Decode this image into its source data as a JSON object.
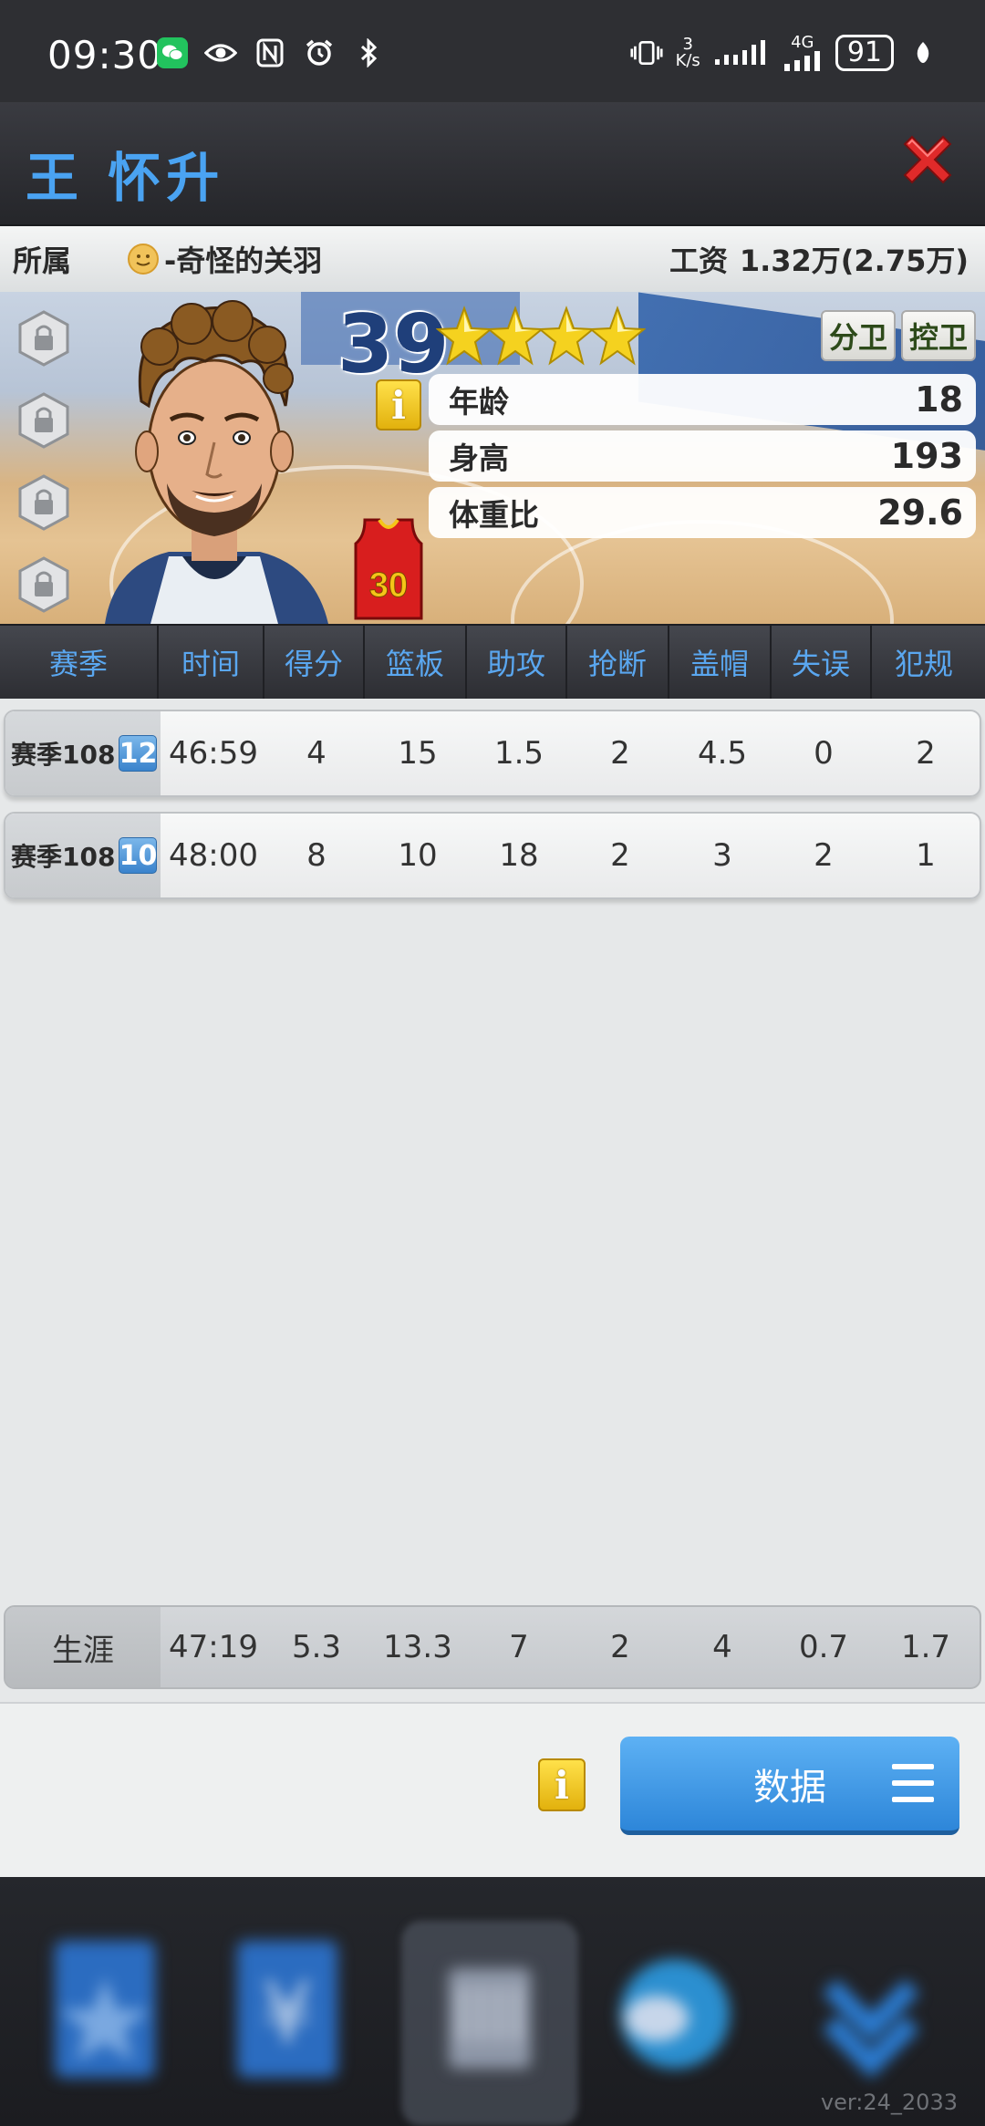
{
  "status_bar": {
    "time": "09:30",
    "net_speed_value": "3",
    "net_speed_unit": "K/s",
    "network_label": "4G",
    "battery": "91",
    "icons": [
      "wechat-icon",
      "eye-icon",
      "nfc-icon",
      "alarm-icon",
      "bluetooth-icon",
      "vibrate-icon",
      "signal-icon",
      "leaf-icon"
    ]
  },
  "header": {
    "player_name": "王 怀升",
    "close_icon": "close-icon"
  },
  "info_bar": {
    "club_label": "所属",
    "club_name": "-奇怪的关羽",
    "wage_label": "工资",
    "wage_value": "1.32万(2.75万)"
  },
  "player": {
    "overall": "39",
    "stars": 4,
    "jersey_number": "30",
    "positions": [
      "分卫",
      "控卫"
    ],
    "attributes": [
      {
        "label": "年龄",
        "value": "18"
      },
      {
        "label": "身高",
        "value": "193"
      },
      {
        "label": "体重比",
        "value": "29.6"
      }
    ],
    "info_icon_text": "i"
  },
  "stats_table": {
    "headers": [
      "赛季",
      "时间",
      "得分",
      "篮板",
      "助攻",
      "抢断",
      "盖帽",
      "失误",
      "犯规"
    ],
    "rows": [
      {
        "season": "赛季108",
        "badge": "12",
        "cells": [
          "46:59",
          "4",
          "15",
          "1.5",
          "2",
          "4.5",
          "0",
          "2"
        ]
      },
      {
        "season": "赛季108",
        "badge": "10",
        "cells": [
          "48:00",
          "8",
          "10",
          "18",
          "2",
          "3",
          "2",
          "1"
        ]
      }
    ],
    "career": {
      "label": "生涯",
      "cells": [
        "47:19",
        "5.3",
        "13.3",
        "7",
        "2",
        "4",
        "0.7",
        "1.7"
      ]
    }
  },
  "bottom": {
    "info_icon_text": "i",
    "data_button_label": "数据"
  },
  "version": "ver:24_2033",
  "colors": {
    "accent_blue": "#4aa3f2",
    "close_red": "#e02a2a",
    "star_gold": "#f5d21f",
    "button_blue": "#3b92e0"
  }
}
